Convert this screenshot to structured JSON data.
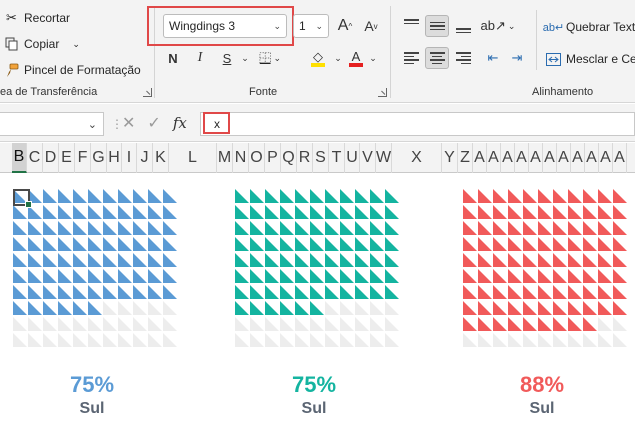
{
  "clipboard": {
    "cut": "Recortar",
    "copy": "Copiar",
    "format_painter": "Pincel de Formatação",
    "group_label": "ea de Transferência"
  },
  "font": {
    "name": "Wingdings 3",
    "size": "1",
    "group_label": "Fonte",
    "bold": "N",
    "italic": "I",
    "underline": "S",
    "grow": "A",
    "shrink": "A",
    "font_color_letter": "A"
  },
  "alignment": {
    "wrap_text": "Quebrar Text",
    "merge": "Mesclar e Ce",
    "group_label": "Alinhamento"
  },
  "formula_bar": {
    "name_box": "",
    "fx": "fx",
    "content": "x"
  },
  "columns": [
    "B",
    "C",
    "D",
    "E",
    "F",
    "G",
    "H",
    "I",
    "J",
    "K",
    "L",
    "M",
    "N",
    "O",
    "P",
    "Q",
    "R",
    "S",
    "T",
    "U",
    "V",
    "W",
    "X",
    "Y",
    "Z",
    "A",
    "A",
    "A",
    "A",
    "A",
    "A",
    "A",
    "A",
    "A",
    "A",
    "A"
  ],
  "charts": [
    {
      "percent": "75%",
      "value": 0.75,
      "region": "Sul",
      "color": "#5b9bd5"
    },
    {
      "percent": "75%",
      "value": 0.75,
      "region": "Sul",
      "color": "#14b4a0"
    },
    {
      "percent": "88%",
      "value": 0.88,
      "region": "Sul",
      "color": "#f15a5a"
    }
  ],
  "colors": {
    "accent_green": "#217346",
    "highlight_red": "#e04848",
    "fill_yellow": "#ffe000",
    "font_red": "#e52020",
    "empty_cell": "#ededed"
  }
}
